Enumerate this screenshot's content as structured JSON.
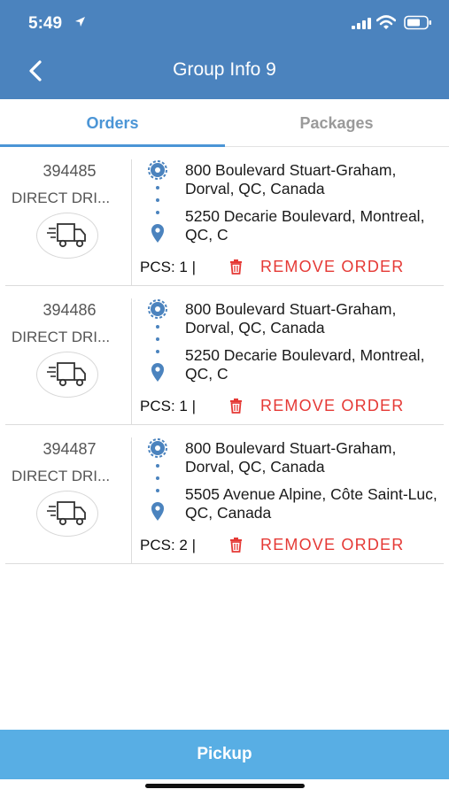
{
  "status_bar": {
    "time": "5:49"
  },
  "nav": {
    "title": "Group Info 9"
  },
  "tabs": [
    {
      "label": "Orders",
      "active": true
    },
    {
      "label": "Packages",
      "active": false
    }
  ],
  "orders": [
    {
      "id": "394485",
      "type": "DIRECT DRI...",
      "from": "800 Boulevard Stuart-Graham, Dorval, QC, Canada",
      "to": " 5250 Decarie Boulevard, Montreal, QC, C",
      "pcs": "PCS: 1 |",
      "remove_label": "REMOVE ORDER"
    },
    {
      "id": "394486",
      "type": "DIRECT DRI...",
      "from": "800 Boulevard Stuart-Graham, Dorval, QC, Canada",
      "to": " 5250 Decarie Boulevard, Montreal, QC, C",
      "pcs": "PCS: 1 |",
      "remove_label": "REMOVE ORDER"
    },
    {
      "id": "394487",
      "type": "DIRECT DRI...",
      "from": "800 Boulevard Stuart-Graham, Dorval, QC, Canada",
      "to": "5505 Avenue Alpine, Côte Saint-Luc, QC, Canada",
      "pcs": "PCS: 2 |",
      "remove_label": "REMOVE ORDER"
    }
  ],
  "footer": {
    "pickup_label": "Pickup"
  },
  "colors": {
    "header": "#4b83be",
    "accent": "#4b95d6",
    "remove": "#e53935",
    "pickup": "#58aee4"
  }
}
